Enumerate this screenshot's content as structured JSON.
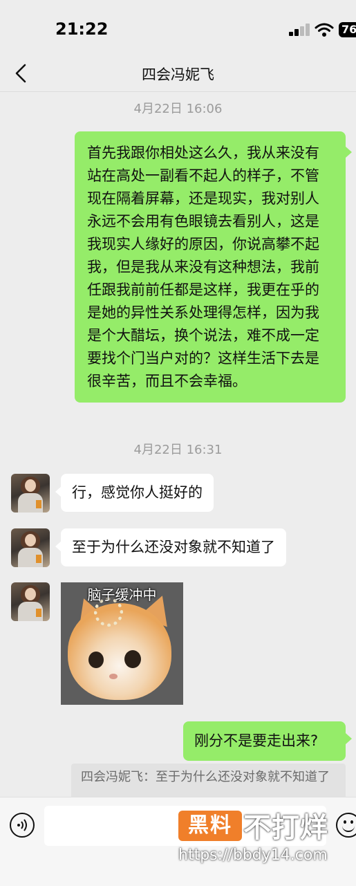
{
  "status": {
    "time": "21:22",
    "battery": "76"
  },
  "header": {
    "title": "四会冯妮飞",
    "back_icon": "chevron-left-icon"
  },
  "messages": {
    "ts1": "4月22日 16:06",
    "out1": "首先我跟你相处这么久，我从来没有站在高处一副看不起人的样子，不管现在隔着屏幕，还是现实，我对别人永远不会用有色眼镜去看别人，这是我现实人缘好的原因，你说高攀不起我，但是我从来没有这种想法，我前任跟我前前任都是这样，我更在乎的是她的异性关系处理得怎样，因为我是个大醋坛，换个说法，难不成一定要找个门当户对的？这样生活下去是很辛苦，而且不会幸福。",
    "ts2": "4月22日 16:31",
    "in1": "行，感觉你人挺好的",
    "in2": "至于为什么还没对象就不知道了",
    "sticker_caption": "脑子缓冲中",
    "out2": "刚分不是要走出来?",
    "quote": "四会冯妮飞：至于为什么还没对象就不知道了"
  },
  "input": {
    "value": "",
    "voice_icon": "voice-icon",
    "emoji_icon": "emoji-icon"
  },
  "watermark": {
    "box": "黑料",
    "text": "不打烊",
    "url": "https://bbdy14.com"
  },
  "colors": {
    "outgoing_bubble": "#95ec69",
    "incoming_bubble": "#ffffff",
    "background": "#ededed",
    "watermark": "#f07f2a"
  }
}
